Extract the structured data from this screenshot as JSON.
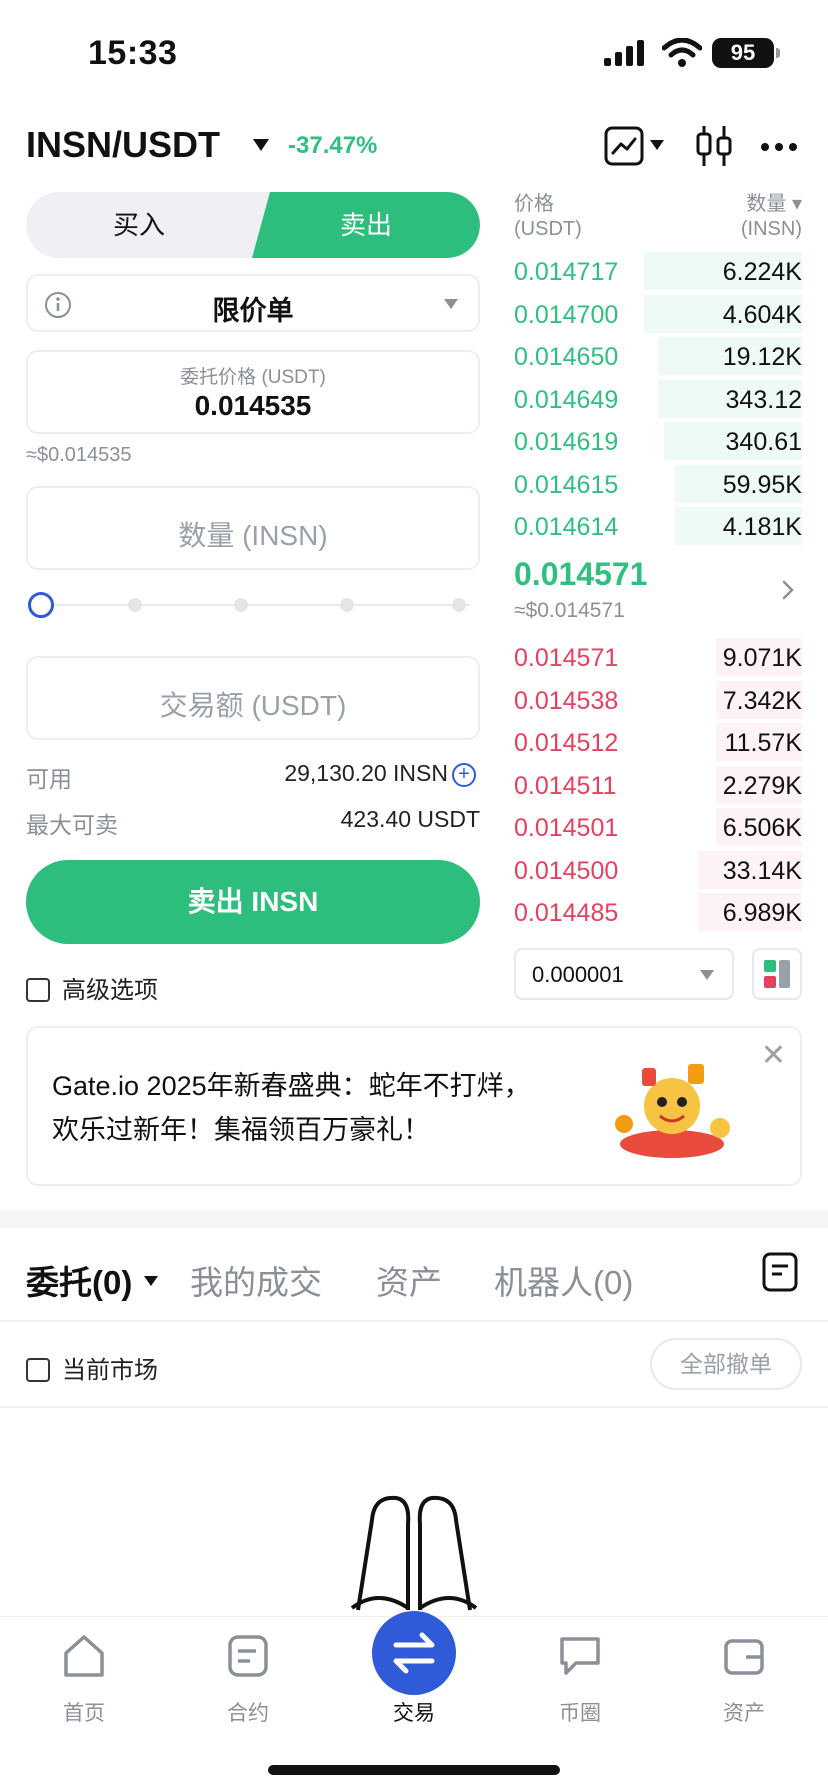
{
  "status": {
    "time": "15:33",
    "battery": "95"
  },
  "header": {
    "pair": "INSN/USDT",
    "change": "-37.47%"
  },
  "trade_tabs": {
    "buy": "买入",
    "sell": "卖出"
  },
  "order_type": "限价单",
  "price_field": {
    "caption": "委托价格 (USDT)",
    "value": "0.014535",
    "approx": "≈$0.014535"
  },
  "quantity_placeholder": "数量 (INSN)",
  "amount_placeholder": "交易额 (USDT)",
  "slider_value": 0,
  "available": {
    "label": "可用",
    "value": "29,130.20 INSN"
  },
  "max_sell": {
    "label": "最大可卖",
    "value": "423.40 USDT"
  },
  "sell_button": "卖出 INSN",
  "advanced": "高级选项",
  "orderbook": {
    "price_header": "价格",
    "price_unit": "(USDT)",
    "qty_header": "数量 ▾",
    "qty_unit": "(INSN)",
    "asks": [
      {
        "price": "0.014717",
        "qty": "6.224K",
        "depth": 0.55
      },
      {
        "price": "0.014700",
        "qty": "4.604K",
        "depth": 0.55
      },
      {
        "price": "0.014650",
        "qty": "19.12K",
        "depth": 0.5
      },
      {
        "price": "0.014649",
        "qty": "343.12",
        "depth": 0.5
      },
      {
        "price": "0.014619",
        "qty": "340.61",
        "depth": 0.48
      },
      {
        "price": "0.014615",
        "qty": "59.95K",
        "depth": 0.44
      },
      {
        "price": "0.014614",
        "qty": "4.181K",
        "depth": 0.44
      }
    ],
    "mid_price": "0.014571",
    "mid_approx": "≈$0.014571",
    "bids": [
      {
        "price": "0.014571",
        "qty": "9.071K",
        "depth": 0.3
      },
      {
        "price": "0.014538",
        "qty": "7.342K",
        "depth": 0.3
      },
      {
        "price": "0.014512",
        "qty": "11.57K",
        "depth": 0.3
      },
      {
        "price": "0.014511",
        "qty": "2.279K",
        "depth": 0.3
      },
      {
        "price": "0.014501",
        "qty": "6.506K",
        "depth": 0.3
      },
      {
        "price": "0.014500",
        "qty": "33.14K",
        "depth": 0.36
      },
      {
        "price": "0.014485",
        "qty": "6.989K",
        "depth": 0.36
      }
    ],
    "precision": "0.000001"
  },
  "banner": {
    "text": "Gate.io 2025年新春盛典：蛇年不打烊，欢乐过新年！集福领百万豪礼！"
  },
  "order_tabs": [
    "委托(0)",
    "我的成交",
    "资产",
    "机器人(0)"
  ],
  "current_market": "当前市场",
  "cancel_all": "全部撤单",
  "nav": [
    "首页",
    "合约",
    "交易",
    "币圈",
    "资产"
  ],
  "colors": {
    "green": "#2dbe7d",
    "red": "#e6405f",
    "blue": "#2f5bd8"
  }
}
